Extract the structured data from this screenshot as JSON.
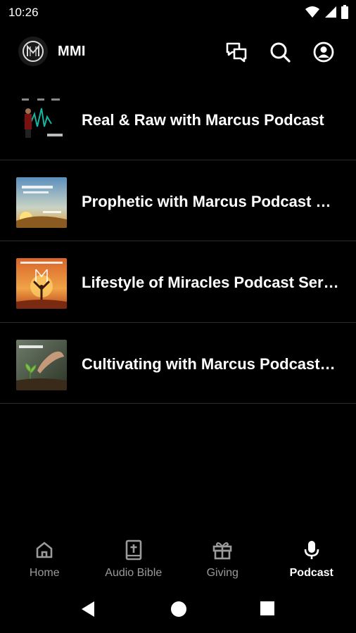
{
  "status_bar": {
    "time": "10:26"
  },
  "app_bar": {
    "title": "MMI"
  },
  "podcasts": [
    {
      "title": "Real & Raw with Marcus Podcast"
    },
    {
      "title": "Prophetic with Marcus Podcast Series"
    },
    {
      "title": "Lifestyle of Miracles Podcast Series"
    },
    {
      "title": "Cultivating with Marcus Podcast Series"
    }
  ],
  "bottom_nav": [
    {
      "label": "Home",
      "icon": "home-icon",
      "active": false
    },
    {
      "label": "Audio Bible",
      "icon": "bible-icon",
      "active": false
    },
    {
      "label": "Giving",
      "icon": "gift-icon",
      "active": false
    },
    {
      "label": "Podcast",
      "icon": "microphone-icon",
      "active": true
    }
  ],
  "colors": {
    "background": "#000000",
    "text": "#ffffff",
    "inactive": "#9a9a9a",
    "divider": "#2a2a2a"
  }
}
